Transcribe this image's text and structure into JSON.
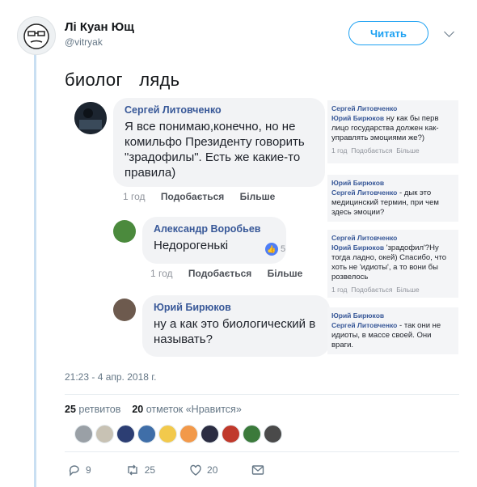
{
  "header": {
    "display_name": "Лі Куан Ющ",
    "handle": "@vitryak",
    "follow_label": "Читать"
  },
  "tweet": {
    "text": "биолог  лядь",
    "timestamp": "21:23 - 4 апр. 2018 г."
  },
  "embedded_comments": [
    {
      "author": "Сергей Литовченко",
      "text": "Я все понимаю,конечно, но не комильфо Президенту говорить \"зрадофилы\". Есть же какие-то правила)",
      "time": "1 год",
      "like": "Подобається",
      "reply": "Більше"
    },
    {
      "author": "Александр Воробьев",
      "text": "Недорогенькі",
      "time": "1 год",
      "like": "Подобається",
      "reply": "Більше",
      "reactions": "5"
    },
    {
      "author": "Юрий Бирюков",
      "text": "ну а как это биологический в называть?"
    }
  ],
  "side_comments": [
    {
      "author": "Сергей Литовченко",
      "mention": "Юрий Бирюков",
      "text": "ну как бы перв лицо государства должен как-управлять эмоциями же?)",
      "time": "1 год",
      "like": "Подобається",
      "reply": "Більше"
    },
    {
      "author": "Юрий Бирюков",
      "mention": "Сергей Литовченко",
      "text": "- дык это медицинский термин, при чем здесь эмоции?"
    },
    {
      "author": "Сергей Литовченко",
      "mention": "Юрий Бирюков",
      "text": "'зрадофил'?Ну тогда ладно, окей) Спасибо, что хоть не 'идиоты', а то вони бы розвелось",
      "time": "1 год",
      "like": "Подобається",
      "reply": "Більше"
    },
    {
      "author": "Юрий Бирюков",
      "mention": "Сергей Литовченко",
      "text": "- так они не идиоты, в массе своей. Они враги."
    }
  ],
  "stats": {
    "retweets_count": "25",
    "retweets_label": "ретвитов",
    "likes_count": "20",
    "likes_label": "отметок «Нравится»"
  },
  "actions": {
    "replies": "9",
    "retweets": "25",
    "likes": "20"
  },
  "colors": {
    "accent": "#1da1f2",
    "fb_name": "#385898",
    "muted": "#657786"
  }
}
